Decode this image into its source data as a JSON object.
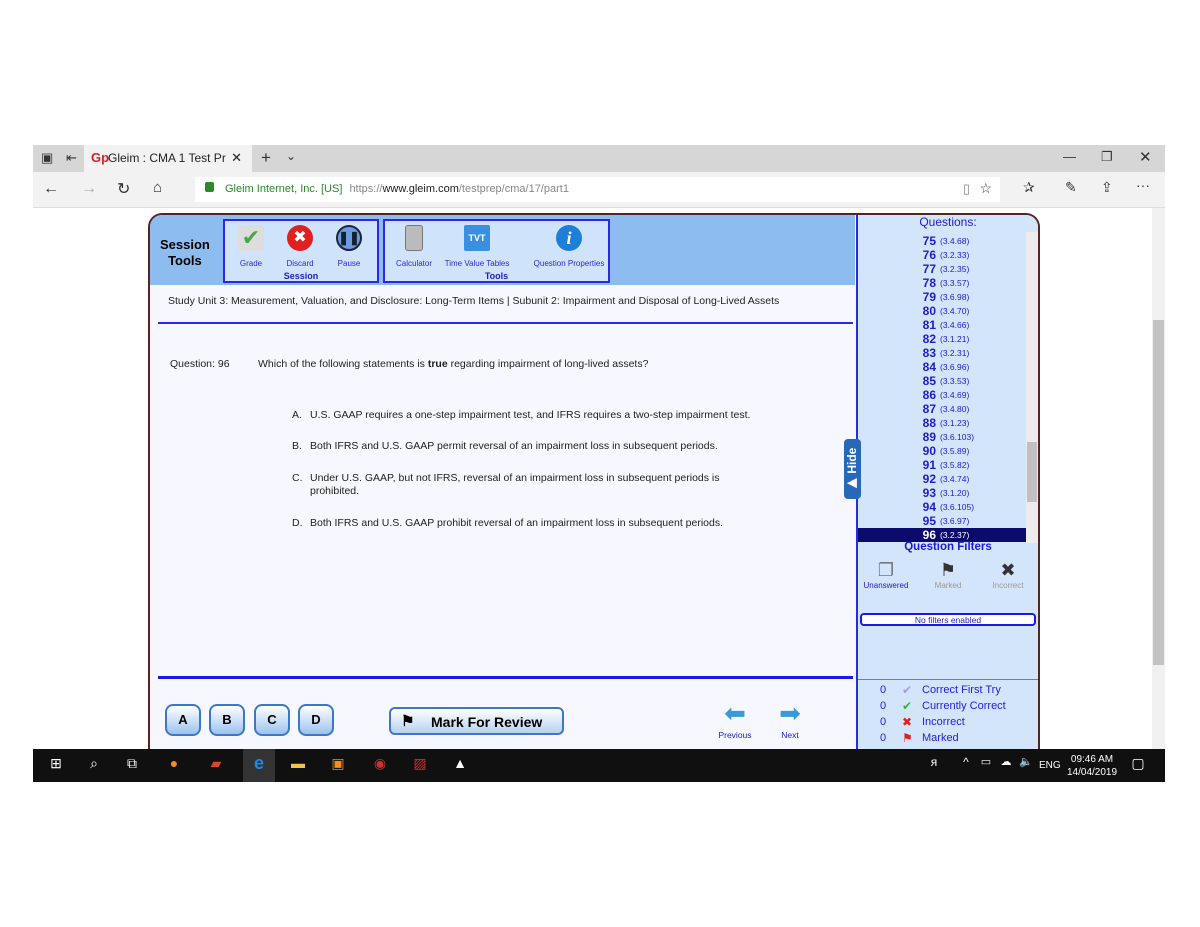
{
  "browser": {
    "tab_title": "Gleim : CMA 1 Test Prep",
    "cert": "Gleim Internet, Inc. [US]",
    "url_prefix": "https://",
    "url_host": "www.gleim.com",
    "url_path": "/testprep/cma/17/part1"
  },
  "header": {
    "title_line1": "Session",
    "title_line2": "Tools",
    "session_group": "Session",
    "tools_group": "Tools",
    "session_tools": [
      {
        "label": "Grade",
        "icon": "grade-check-icon"
      },
      {
        "label": "Discard",
        "icon": "discard-x-icon"
      },
      {
        "label": "Pause",
        "icon": "pause-icon"
      }
    ],
    "tools": [
      {
        "label": "Calculator",
        "icon": "calculator-icon"
      },
      {
        "label": "Time Value Tables",
        "icon": "tvt-icon",
        "glyph": "TVT"
      },
      {
        "label": "Question Properties",
        "icon": "info-icon",
        "glyph": "i"
      }
    ]
  },
  "study_unit": "Study Unit 3: Measurement, Valuation, and Disclosure: Long-Term Items | Subunit 2: Impairment and Disposal of Long-Lived Assets",
  "question": {
    "label": "Question: 96",
    "text_before": "Which of the following statements is ",
    "text_bold": "true",
    "text_after": " regarding impairment of long-lived assets?",
    "options": [
      {
        "letter": "A.",
        "text": "U.S. GAAP requires a one-step impairment test, and IFRS requires a two-step impairment test."
      },
      {
        "letter": "B.",
        "text": "Both IFRS and U.S. GAAP permit reversal of an impairment loss in subsequent periods."
      },
      {
        "letter": "C.",
        "text": "Under U.S. GAAP, but not IFRS, reversal of an impairment loss in subsequent periods is prohibited."
      },
      {
        "letter": "D.",
        "text": "Both IFRS and U.S. GAAP prohibit reversal of an impairment loss in subsequent periods."
      }
    ]
  },
  "answer_buttons": [
    "A",
    "B",
    "C",
    "D"
  ],
  "mark_review": "Mark For Review",
  "previous": "Previous",
  "next": "Next",
  "hide": "▶ Hide",
  "sidebar": {
    "questions_title": "Questions:",
    "questions": [
      {
        "n": "75",
        "c": "(3.4.68)"
      },
      {
        "n": "76",
        "c": "(3.2.33)"
      },
      {
        "n": "77",
        "c": "(3.2.35)"
      },
      {
        "n": "78",
        "c": "(3.3.57)"
      },
      {
        "n": "79",
        "c": "(3.6.98)"
      },
      {
        "n": "80",
        "c": "(3.4.70)"
      },
      {
        "n": "81",
        "c": "(3.4.66)"
      },
      {
        "n": "82",
        "c": "(3.1.21)"
      },
      {
        "n": "83",
        "c": "(3.2.31)"
      },
      {
        "n": "84",
        "c": "(3.6.96)"
      },
      {
        "n": "85",
        "c": "(3.3.53)"
      },
      {
        "n": "86",
        "c": "(3.4.69)"
      },
      {
        "n": "87",
        "c": "(3.4.80)"
      },
      {
        "n": "88",
        "c": "(3.1.23)"
      },
      {
        "n": "89",
        "c": "(3.6.103)"
      },
      {
        "n": "90",
        "c": "(3.5.89)"
      },
      {
        "n": "91",
        "c": "(3.5.82)"
      },
      {
        "n": "92",
        "c": "(3.4.74)"
      },
      {
        "n": "93",
        "c": "(3.1.20)"
      },
      {
        "n": "94",
        "c": "(3.6.105)"
      },
      {
        "n": "95",
        "c": "(3.6.97)"
      },
      {
        "n": "96",
        "c": "(3.2.37)"
      }
    ],
    "selected": "96",
    "filters_title": "Question Filters",
    "filters": [
      "Unanswered",
      "Marked",
      "Incorrect"
    ],
    "filter_status": "No filters enabled",
    "stats": [
      {
        "count": "0",
        "label": "Correct First Try",
        "icon": "check-purple-icon"
      },
      {
        "count": "0",
        "label": "Currently Correct",
        "icon": "check-green-icon"
      },
      {
        "count": "0",
        "label": "Incorrect",
        "icon": "x-red-icon"
      },
      {
        "count": "0",
        "label": "Marked",
        "icon": "flag-red-icon"
      }
    ]
  },
  "taskbar": {
    "time": "09:46 AM",
    "date": "14/04/2019",
    "lang": "ENG"
  }
}
